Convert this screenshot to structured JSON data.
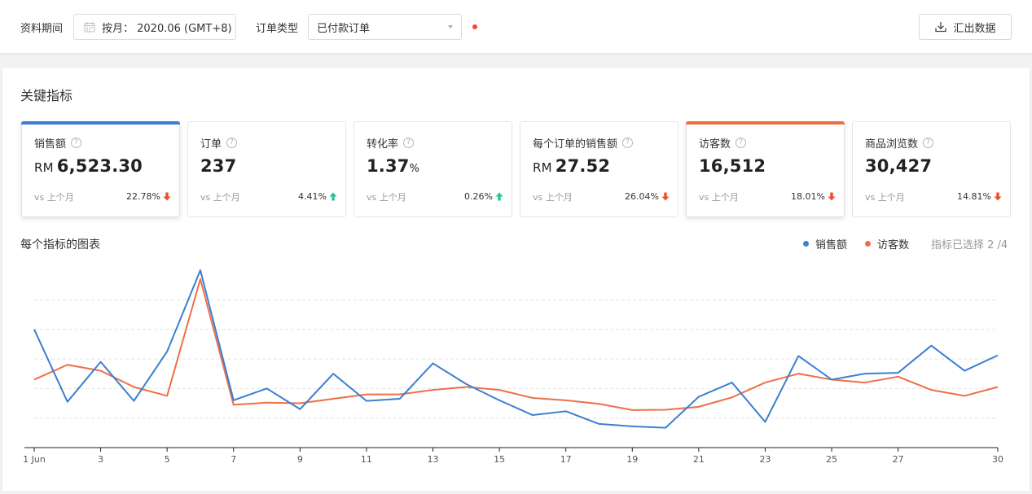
{
  "filters": {
    "period_label": "资料期间",
    "period_value": "按月： 2020.06 (GMT+8)",
    "order_type_label": "订单类型",
    "order_type_value": "已付款订单",
    "export_label": "汇出数据"
  },
  "section": {
    "title": "关键指标"
  },
  "metrics": [
    {
      "name": "销售额",
      "prefix": "RM",
      "value": "6,523.30",
      "suffix": "",
      "vs": "vs 上个月",
      "change": "22.78%",
      "trend": "down",
      "selected": true,
      "accent": "#3b7fd0"
    },
    {
      "name": "订单",
      "prefix": "",
      "value": "237",
      "suffix": "",
      "vs": "vs 上个月",
      "change": "4.41%",
      "trend": "up",
      "selected": false,
      "accent": ""
    },
    {
      "name": "转化率",
      "prefix": "",
      "value": "1.37",
      "suffix": "%",
      "vs": "vs 上个月",
      "change": "0.26%",
      "trend": "up",
      "selected": false,
      "accent": ""
    },
    {
      "name": "每个订单的销售额",
      "prefix": "RM",
      "value": "27.52",
      "suffix": "",
      "vs": "vs 上个月",
      "change": "26.04%",
      "trend": "down",
      "selected": false,
      "accent": ""
    },
    {
      "name": "访客数",
      "prefix": "",
      "value": "16,512",
      "suffix": "",
      "vs": "vs 上个月",
      "change": "18.01%",
      "trend": "down",
      "selected": true,
      "accent": "#ee6f47"
    },
    {
      "name": "商品浏览数",
      "prefix": "",
      "value": "30,427",
      "suffix": "",
      "vs": "vs 上个月",
      "change": "14.81%",
      "trend": "down",
      "selected": false,
      "accent": ""
    }
  ],
  "chart_panel": {
    "title": "每个指标的图表",
    "legend": [
      {
        "name": "销售额",
        "color": "#3b7fd0"
      },
      {
        "name": "访客数",
        "color": "#ee6f47"
      }
    ],
    "selected_info": "指标已选择 2 /4"
  },
  "colors": {
    "down": "#ee4d2d",
    "up": "#26c39e"
  },
  "chart_data": {
    "type": "line",
    "x": [
      1,
      2,
      3,
      4,
      5,
      6,
      7,
      8,
      9,
      10,
      11,
      12,
      13,
      14,
      15,
      16,
      17,
      18,
      19,
      20,
      21,
      22,
      23,
      24,
      25,
      26,
      27,
      28,
      29,
      30
    ],
    "xtick_labels": [
      "1 Jun",
      "3",
      "5",
      "7",
      "9",
      "11",
      "13",
      "15",
      "17",
      "19",
      "21",
      "23",
      "25",
      "27",
      "30"
    ],
    "xtick_positions": [
      1,
      3,
      5,
      7,
      9,
      11,
      13,
      15,
      17,
      19,
      21,
      23,
      25,
      27,
      30
    ],
    "ylim": [
      0,
      6
    ],
    "grid": true,
    "series": [
      {
        "name": "销售额",
        "color": "#3b7fd0",
        "values": [
          4.0,
          1.55,
          2.9,
          1.58,
          3.25,
          6.0,
          1.6,
          2.0,
          1.3,
          2.5,
          1.58,
          1.65,
          2.85,
          2.15,
          1.6,
          1.1,
          1.23,
          0.8,
          0.72,
          0.67,
          1.72,
          2.2,
          0.87,
          3.1,
          2.3,
          2.5,
          2.53,
          3.45,
          2.6,
          3.12
        ]
      },
      {
        "name": "访客数",
        "color": "#ee6f47",
        "values": [
          2.3,
          2.8,
          2.6,
          2.05,
          1.75,
          5.7,
          1.45,
          1.52,
          1.5,
          1.65,
          1.8,
          1.8,
          1.95,
          2.05,
          1.95,
          1.68,
          1.6,
          1.48,
          1.27,
          1.28,
          1.38,
          1.7,
          2.2,
          2.5,
          2.3,
          2.2,
          2.4,
          1.95,
          1.75,
          2.05
        ]
      }
    ]
  }
}
